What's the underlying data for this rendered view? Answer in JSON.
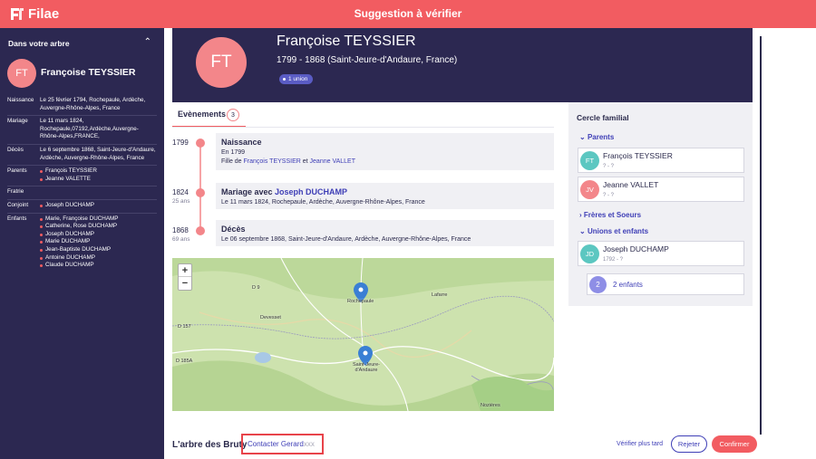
{
  "app": {
    "logo_text": "Filae",
    "title": "Suggestion à vérifier"
  },
  "sidebar": {
    "heading": "Dans votre arbre",
    "avatar_initials": "FT",
    "person_name": "Françoise TEYSSIER",
    "rows": [
      {
        "label": "Naissance",
        "value": "Le 25 février 1794, Rochepaule, Ardèche, Auvergne-Rhône-Alpes, France"
      },
      {
        "label": "Mariage",
        "value": "Le 11 mars 1824, Rochepaule,07192,Ardèche,Auvergne-Rhône-Alpes,FRANCE,"
      },
      {
        "label": "Décès",
        "value": "Le 6 septembre 1868, Saint-Jeure-d'Andaure, Ardèche, Auvergne-Rhône-Alpes, France"
      }
    ],
    "parents_label": "Parents",
    "parents": [
      "François TEYSSIER",
      "Jeanne VALETTE"
    ],
    "siblings_label": "Fratrie",
    "spouse_label": "Conjoint",
    "spouse": [
      "Joseph DUCHAMP"
    ],
    "children_label": "Enfants",
    "children": [
      "Marie, Françoise DUCHAMP",
      "Catherine, Rose DUCHAMP",
      "Joseph DUCHAMP",
      "Marie DUCHAMP",
      "Jean-Baptiste DUCHAMP",
      "Antoine DUCHAMP",
      "Claude DUCHAMP"
    ]
  },
  "person": {
    "initials": "FT",
    "name": "Françoise TEYSSIER",
    "dates": "1799 - 1868 (Saint-Jeure-d'Andaure, France)",
    "badge": "1 union"
  },
  "events_tab": {
    "label": "Evènements",
    "count": "3"
  },
  "events": [
    {
      "year": "1799",
      "age": "",
      "title": "Naissance",
      "title_link": "",
      "line1": "En 1799",
      "line2_prefix": "Fille de ",
      "father": "François TEYSSIER",
      "line2_mid": " et ",
      "mother": "Jeanne VALLET"
    },
    {
      "year": "1824",
      "age": "25 ans",
      "title": "Mariage avec ",
      "title_link": "Joseph DUCHAMP",
      "line1": "Le 11 mars 1824, Rochepaule, Ardèche, Auvergne-Rhône-Alpes, France"
    },
    {
      "year": "1868",
      "age": "69 ans",
      "title": "Décès",
      "title_link": "",
      "line1": "Le 06 septembre 1868, Saint-Jeure-d'Andaure, Ardèche, Auvergne-Rhône-Alpes, France"
    }
  ],
  "map": {
    "zoom_in": "+",
    "zoom_out": "−",
    "labels": {
      "d9": "D 9",
      "rochepaule": "Rochepaule",
      "lafarre": "Lafarre",
      "devesset": "Devesset",
      "d157": "D 157",
      "d185a": "D 185A",
      "saint_jeure": "Saint-Jeure-d'Andaure",
      "nozieres": "Nozières"
    }
  },
  "family": {
    "title": "Cercle familial",
    "parents_label": "Parents",
    "parents": [
      {
        "initials": "FT",
        "name": "François TEYSSIER",
        "dates": "? - ?",
        "color": "#5cc7c1"
      },
      {
        "initials": "JV",
        "name": "Jeanne VALLET",
        "dates": "? - ?",
        "color": "#f3868a"
      }
    ],
    "siblings_label": "Frères et Soeurs",
    "unions_label": "Unions et enfants",
    "spouse": {
      "initials": "JD",
      "name": "Joseph DUCHAMP",
      "dates": "1792 - ?",
      "color": "#5cc7c1"
    },
    "children_count": "2",
    "children_label": "2 enfants"
  },
  "footer": {
    "tree_title": "L'arbre des Bruty",
    "contact_label": "Contacter Gerard",
    "contact_suffix": "xxx",
    "later_label": "Vérifier plus tard",
    "reject_label": "Rejeter",
    "confirm_label": "Confirmer"
  }
}
